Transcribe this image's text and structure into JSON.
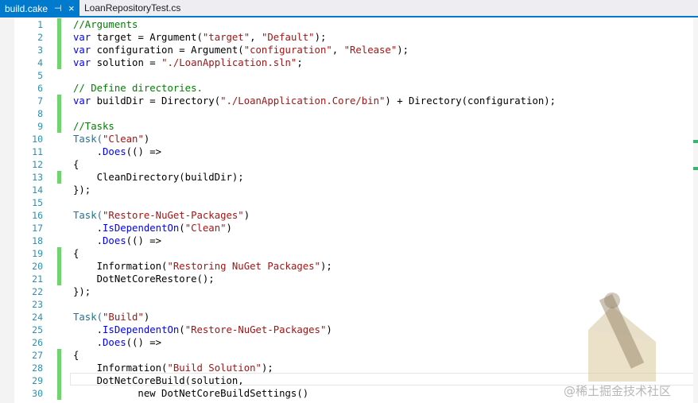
{
  "tabs": [
    {
      "label": "build.cake",
      "active": true,
      "pin_icon": "pin-icon",
      "close_icon": "close-icon"
    },
    {
      "label": "LoanRepositoryTest.cs",
      "active": false
    }
  ],
  "lines": [
    {
      "n": "1",
      "changed": true,
      "segs": [
        {
          "t": "//Arguments",
          "c": "cm"
        }
      ]
    },
    {
      "n": "2",
      "changed": true,
      "segs": [
        {
          "t": "var",
          "c": "kw"
        },
        {
          "t": " target = Argument(",
          "c": ""
        },
        {
          "t": "\"target\"",
          "c": "str"
        },
        {
          "t": ", ",
          "c": ""
        },
        {
          "t": "\"Default\"",
          "c": "str"
        },
        {
          "t": ");",
          "c": ""
        }
      ]
    },
    {
      "n": "3",
      "changed": true,
      "segs": [
        {
          "t": "var",
          "c": "kw"
        },
        {
          "t": " configuration = Argument(",
          "c": ""
        },
        {
          "t": "\"configuration\"",
          "c": "str"
        },
        {
          "t": ", ",
          "c": ""
        },
        {
          "t": "\"Release\"",
          "c": "str"
        },
        {
          "t": ");",
          "c": ""
        }
      ]
    },
    {
      "n": "4",
      "changed": true,
      "segs": [
        {
          "t": "var",
          "c": "kw"
        },
        {
          "t": " solution = ",
          "c": ""
        },
        {
          "t": "\"./LoanApplication.sln\"",
          "c": "str"
        },
        {
          "t": ";",
          "c": ""
        }
      ]
    },
    {
      "n": "5",
      "changed": false,
      "segs": []
    },
    {
      "n": "6",
      "changed": false,
      "segs": [
        {
          "t": "// Define directories.",
          "c": "cm"
        }
      ]
    },
    {
      "n": "7",
      "changed": true,
      "segs": [
        {
          "t": "var",
          "c": "kw"
        },
        {
          "t": " buildDir = Directory(",
          "c": ""
        },
        {
          "t": "\"./LoanApplication.Core/bin\"",
          "c": "str"
        },
        {
          "t": ") + Directory(configuration);",
          "c": ""
        }
      ]
    },
    {
      "n": "8",
      "changed": true,
      "segs": []
    },
    {
      "n": "9",
      "changed": true,
      "segs": [
        {
          "t": "//Tasks",
          "c": "cm"
        }
      ]
    },
    {
      "n": "10",
      "changed": false,
      "segs": [
        {
          "t": "Task(",
          "c": "cls"
        },
        {
          "t": "\"Clean\"",
          "c": "str"
        },
        {
          "t": ")",
          "c": ""
        }
      ]
    },
    {
      "n": "11",
      "changed": false,
      "segs": [
        {
          "t": "    .",
          "c": ""
        },
        {
          "t": "Does",
          "c": "fn"
        },
        {
          "t": "(() =>",
          "c": ""
        }
      ]
    },
    {
      "n": "12",
      "changed": false,
      "segs": [
        {
          "t": "{",
          "c": ""
        }
      ]
    },
    {
      "n": "13",
      "changed": true,
      "segs": [
        {
          "t": "    CleanDirectory(buildDir);",
          "c": ""
        }
      ]
    },
    {
      "n": "14",
      "changed": false,
      "segs": [
        {
          "t": "});",
          "c": ""
        }
      ]
    },
    {
      "n": "15",
      "changed": false,
      "segs": []
    },
    {
      "n": "16",
      "changed": false,
      "segs": [
        {
          "t": "Task(",
          "c": "cls"
        },
        {
          "t": "\"Restore-NuGet-Packages\"",
          "c": "str"
        },
        {
          "t": ")",
          "c": ""
        }
      ]
    },
    {
      "n": "17",
      "changed": false,
      "segs": [
        {
          "t": "    .",
          "c": ""
        },
        {
          "t": "IsDependentOn",
          "c": "fn"
        },
        {
          "t": "(",
          "c": ""
        },
        {
          "t": "\"Clean\"",
          "c": "str"
        },
        {
          "t": ")",
          "c": ""
        }
      ]
    },
    {
      "n": "18",
      "changed": false,
      "segs": [
        {
          "t": "    .",
          "c": ""
        },
        {
          "t": "Does",
          "c": "fn"
        },
        {
          "t": "(() =>",
          "c": ""
        }
      ]
    },
    {
      "n": "19",
      "changed": true,
      "segs": [
        {
          "t": "{",
          "c": ""
        }
      ]
    },
    {
      "n": "20",
      "changed": true,
      "segs": [
        {
          "t": "    Information(",
          "c": ""
        },
        {
          "t": "\"Restoring NuGet Packages\"",
          "c": "str"
        },
        {
          "t": ");",
          "c": ""
        }
      ]
    },
    {
      "n": "21",
      "changed": true,
      "segs": [
        {
          "t": "    DotNetCoreRestore();",
          "c": ""
        }
      ]
    },
    {
      "n": "22",
      "changed": false,
      "segs": [
        {
          "t": "});",
          "c": ""
        }
      ]
    },
    {
      "n": "23",
      "changed": false,
      "segs": []
    },
    {
      "n": "24",
      "changed": false,
      "segs": [
        {
          "t": "Task(",
          "c": "cls"
        },
        {
          "t": "\"Build\"",
          "c": "str"
        },
        {
          "t": ")",
          "c": ""
        }
      ]
    },
    {
      "n": "25",
      "changed": false,
      "segs": [
        {
          "t": "    .",
          "c": ""
        },
        {
          "t": "IsDependentOn",
          "c": "fn"
        },
        {
          "t": "(",
          "c": ""
        },
        {
          "t": "\"Restore-NuGet-Packages\"",
          "c": "str"
        },
        {
          "t": ")",
          "c": ""
        }
      ]
    },
    {
      "n": "26",
      "changed": false,
      "segs": [
        {
          "t": "    .",
          "c": ""
        },
        {
          "t": "Does",
          "c": "fn"
        },
        {
          "t": "(() =>",
          "c": ""
        }
      ]
    },
    {
      "n": "27",
      "changed": true,
      "segs": [
        {
          "t": "{",
          "c": ""
        }
      ]
    },
    {
      "n": "28",
      "changed": true,
      "segs": [
        {
          "t": "    Information(",
          "c": ""
        },
        {
          "t": "\"Build Solution\"",
          "c": "str"
        },
        {
          "t": ");",
          "c": ""
        }
      ]
    },
    {
      "n": "29",
      "changed": true,
      "segs": [
        {
          "t": "    DotNetCoreBuild(solution,",
          "c": ""
        }
      ]
    },
    {
      "n": "30",
      "changed": true,
      "segs": [
        {
          "t": "           new DotNetCoreBuildSettings()",
          "c": ""
        }
      ]
    }
  ],
  "watermark": "@稀土掘金技术社区",
  "colors": {
    "accent": "#007acc",
    "change_bar": "#6fd36f",
    "keyword": "#0000ff",
    "string": "#a31515",
    "comment": "#008000",
    "line_number": "#2b91af"
  }
}
